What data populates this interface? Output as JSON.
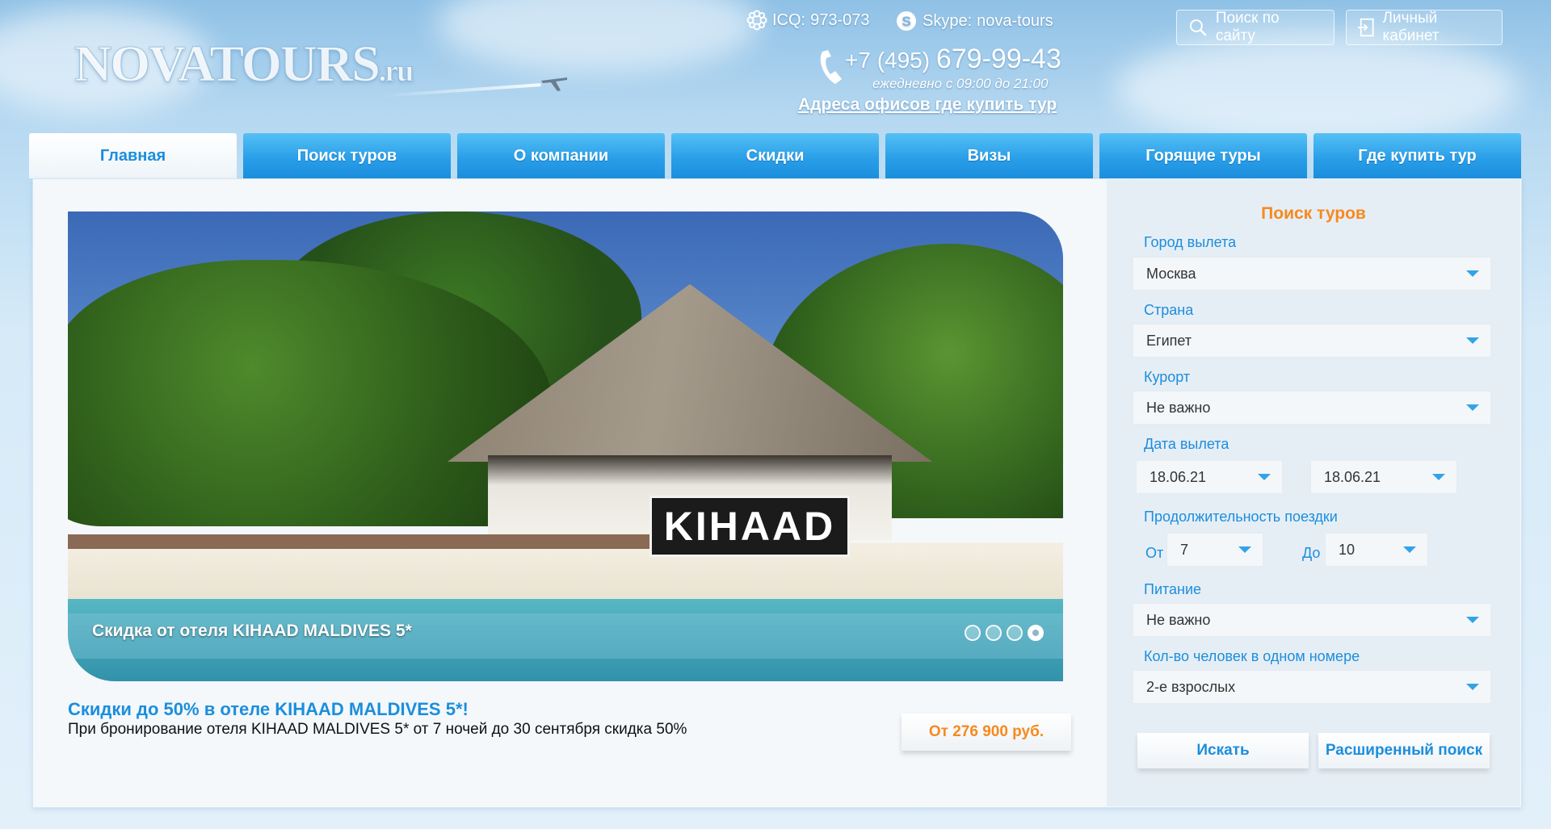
{
  "header": {
    "logo": "NOVATOURS.ru",
    "logo_main": "NOVATOURS",
    "logo_suffix": ".ru",
    "icq_label": "ICQ:",
    "icq_value": "973-073",
    "skype_label": "Skype:",
    "skype_value": "nova-tours",
    "phone_prefix": "+7 (495)",
    "phone_number": "679-99-43",
    "hours": "ежедневно с 09:00 до 21:00",
    "offices_link": "Адреса офисов где купить тур",
    "search_site": "Поиск по сайту",
    "cabinet": "Личный кабинет"
  },
  "nav": {
    "tabs": [
      {
        "label": "Главная",
        "active": true
      },
      {
        "label": "Поиск туров"
      },
      {
        "label": "О компании"
      },
      {
        "label": "Скидки"
      },
      {
        "label": "Визы"
      },
      {
        "label": "Горящие туры"
      },
      {
        "label": "Где купить тур"
      }
    ]
  },
  "slider": {
    "sign_text": "KIHAAD",
    "caption": "Скидка от отеля KIHAAD MALDIVES 5*",
    "slide_count": 4,
    "active_slide": 4
  },
  "promo": {
    "title": "Скидки до 50% в отеле KIHAAD MALDIVES 5*!",
    "text": "При бронирование отеля KIHAAD MALDIVES 5* от 7 ночей до 30 сентября скидка 50%",
    "price": "От 276 900 руб."
  },
  "search_form": {
    "title": "Поиск туров",
    "departure_city_label": "Город вылета",
    "departure_city_value": "Москва",
    "country_label": "Страна",
    "country_value": "Египет",
    "resort_label": "Курорт",
    "resort_value": "Не важно",
    "date_label": "Дата вылета",
    "date_from": "18.06.21",
    "date_to": "18.06.21",
    "duration_label": "Продолжительность поездки",
    "duration_from_label": "От",
    "duration_from_value": "7",
    "duration_to_label": "До",
    "duration_to_value": "10",
    "meal_label": "Питание",
    "meal_value": "Не важно",
    "people_label": "Кол-во человек в одном номере",
    "people_value": "2-е взрослых",
    "search_button": "Искать",
    "advanced_button": "Расширенный поиск"
  },
  "colors": {
    "accent_blue": "#1b8edd",
    "accent_orange": "#f7891f",
    "tab_blue": "#2a9fe8"
  }
}
